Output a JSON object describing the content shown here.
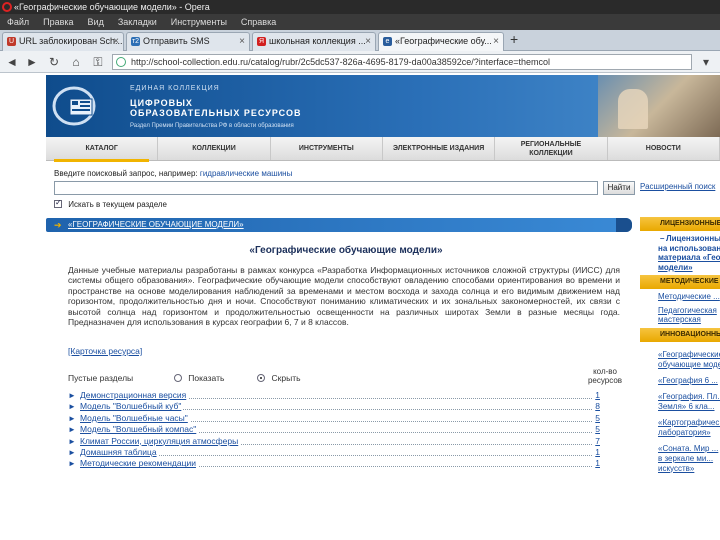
{
  "browser": {
    "window_title": "«Географические обучающие модели» - Opera",
    "menu": [
      "Файл",
      "Правка",
      "Вид",
      "Закладки",
      "Инструменты",
      "Справка"
    ],
    "tabs": [
      {
        "label": "URL заблокирован Sch...",
        "favicon_color": "#c0392b",
        "favicon_text": "U"
      },
      {
        "label": "Отправить SMS",
        "favicon_color": "#2d6fb5",
        "favicon_text": "т2"
      },
      {
        "label": "школьная коллекция ...",
        "favicon_color": "#d22020",
        "favicon_text": "Я"
      },
      {
        "label": "«Географические обу...",
        "favicon_color": "#2a5d9c",
        "favicon_text": "е"
      }
    ],
    "new_tab_symbol": "+",
    "url": "http://school-collection.edu.ru/catalog/rubr/2c5dc537-826a-4695-8179-da00a38592ce/?interface=themcol"
  },
  "site": {
    "header_top": "ЕДИНАЯ КОЛЛЕКЦИЯ",
    "header_title_1": "ЦИФРОВЫХ",
    "header_title_2": "ОБРАЗОВАТЕЛЬНЫХ РЕСУРСОВ",
    "header_sub": "Раздел Премии Правительства РФ в области образования",
    "nav": [
      {
        "label": "КАТАЛОГ",
        "selected": true
      },
      {
        "label": "КОЛЛЕКЦИИ"
      },
      {
        "label": "ИНСТРУМЕНТЫ"
      },
      {
        "label": "ЭЛЕКТРОННЫЕ ИЗДАНИЯ"
      },
      {
        "label": "РЕГИОНАЛЬНЫЕ КОЛЛЕКЦИИ",
        "line1": "РЕГИОНАЛЬНЫЕ",
        "line2": "КОЛЛЕКЦИИ"
      },
      {
        "label": "НОВОСТИ"
      }
    ]
  },
  "search": {
    "label": "Введите поисковый запрос, например:",
    "example": "гидравлические машины",
    "value": "",
    "button": "Найти",
    "advanced": "Расширенный поиск",
    "checkbox_label": "Искать в текущем разделе"
  },
  "section": {
    "arrow": "➔",
    "breadcrumb": "«ГЕОГРАФИЧЕСКИЕ ОБУЧАЮЩИЕ МОДЕЛИ»",
    "title": "«Географические обучающие модели»",
    "description": "Данные учебные материалы разработаны в рамках конкурса «Разработка Информационных источников сложной структуры (ИИСС) для системы общего образования». Географические обучающие модели способствуют овладению способами ориентирования во времени и пространстве на основе моделирования наблюдений за временами и местом восхода и захода солнца и его видимым движением над горизонтом, продолжительностью дня и ночи. Способствуют пониманию климатических и их зональных закономерностей, их связи с высотой солнца над горизонтом и продолжительностью освещенности на различных широтах Земли в разные месяцы года. Предназначен для использования в курсах географии 6, 7 и 8 классов.",
    "card_link": "[Карточка ресурса]",
    "empty_sections": "Пустые разделы",
    "show_option": "Показать",
    "hide_option": "Скрыть",
    "count_header_1": "кол-во",
    "count_header_2": "ресурсов",
    "items": [
      {
        "label": "Демонстрационная версия",
        "count": "1"
      },
      {
        "label": "Модель \"Волшебный куб\"",
        "count": "8"
      },
      {
        "label": "Модель \"Волшебные часы\"",
        "count": "5"
      },
      {
        "label": "Модель \"Волшебный компас\"",
        "count": "5"
      },
      {
        "label": "Климат России, циркуляция атмосферы",
        "count": "7"
      },
      {
        "label": "Домашняя таблица",
        "count": "1"
      },
      {
        "label": "Методические рекомендации",
        "count": "1"
      }
    ]
  },
  "sidebar": {
    "head_licensed": "ЛИЦЕНЗИОННЫЕ",
    "licensed_text_1": "Лицензионный",
    "licensed_text_2": "на использование",
    "licensed_text_3": "материала «Гео...",
    "licensed_text_4": "модели»",
    "head_methodical": "МЕТОДИЧЕСКИЕ",
    "methodical_1": "Методические ...",
    "methodical_2a": "Педагогическая",
    "methodical_2b": "мастерская",
    "head_innovative": "ИННОВАЦИОННЫЕ",
    "innov_1a": "«Географические",
    "innov_1b": "обучающие модели»",
    "innov_2": "«География 6 ...",
    "innov_3a": "«География. Пл...",
    "innov_3b": "Земля» 6 кла...",
    "innov_4a": "«Картографичес...",
    "innov_4b": "лаборатория»",
    "innov_5a": "«Соната. Мир ...",
    "innov_5b": "в зеркале ми...",
    "innov_5c": "искусств»"
  }
}
